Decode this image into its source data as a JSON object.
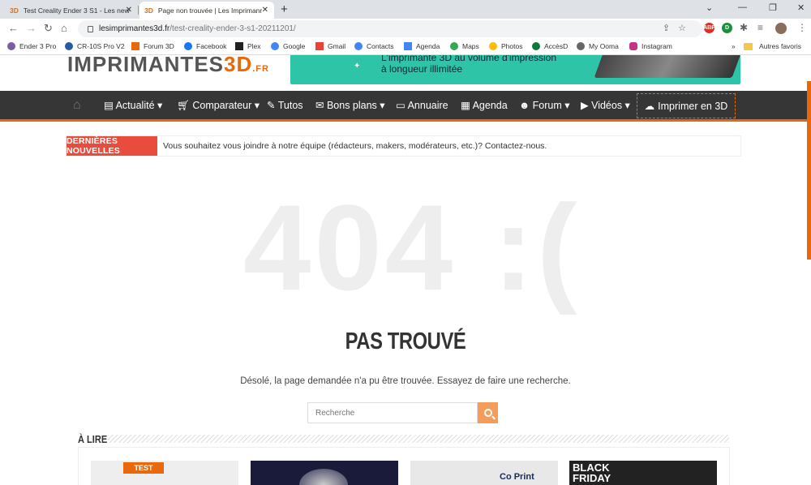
{
  "browser": {
    "tabs": [
      {
        "favicon": "3D",
        "title": "Test Creality Ender 3 S1 - Les new",
        "active": false
      },
      {
        "favicon": "3D",
        "title": "Page non trouvée | Les Imprimanr",
        "active": true
      }
    ],
    "url_host": "lesimprimantes3d.fr",
    "url_path": "/test-creality-ender-3-s1-20211201/",
    "bookmarks": [
      "Ender 3 Pro",
      "CR-10S Pro V2",
      "Forum 3D",
      "Facebook",
      "Plex",
      "Google",
      "Gmail",
      "Contacts",
      "Agenda",
      "Maps",
      "Photos",
      "AccèsD",
      "My Ooma",
      "Instagram"
    ],
    "other_bookmarks": "Autres favoris"
  },
  "site": {
    "logo_main": "IMPRIMANTES",
    "logo_3d": "3D",
    "logo_tld": ".FR",
    "banner_line1": "L'imprimante 3D au volume d'impression",
    "banner_line2": "à longueur illimitée",
    "nav": [
      "Actualité ▾",
      "Comparateur ▾",
      "Tutos",
      "Bons plans ▾",
      "Annuaire",
      "Agenda",
      "Forum ▾",
      "Vidéos ▾"
    ],
    "nav_special": "Imprimer en 3D",
    "news_label": "DERNIÈRES NOUVELLES",
    "news_text": "Vous souhaitez vous joindre à notre équipe (rédacteurs, makers, modérateurs, etc.)? Contactez-nous."
  },
  "error": {
    "big": "404 :(",
    "title": "PAS TROUVÉ",
    "message": "Désolé, la page demandée n'a pu être trouvée. Essayez de faire une recherche.",
    "search_placeholder": "Recherche"
  },
  "section": {
    "title": "À LIRE",
    "card_labels": [
      "TEST",
      "Co Print",
      "BLACK FRIDAY"
    ]
  },
  "colors": {
    "accent": "#e8690c",
    "news_red": "#e74c3c",
    "nav_bg": "#363636"
  }
}
